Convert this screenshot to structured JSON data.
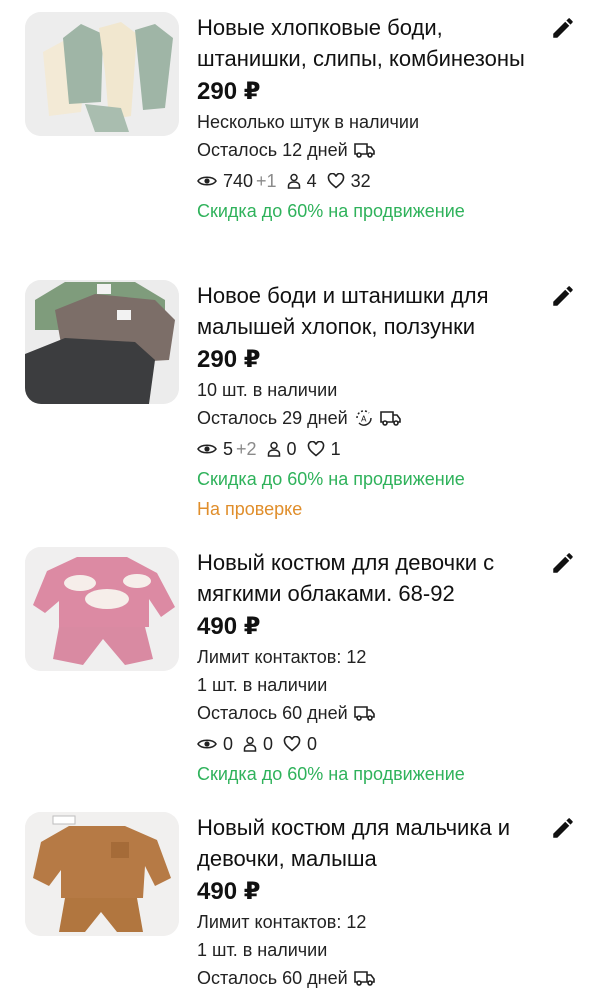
{
  "listings": [
    {
      "title": "Новые хлопковые боди, штанишки, слипы, комбинезоны",
      "price": "290 ₽",
      "stock": "Несколько штук в наличии",
      "days_left": "Осталось 12 дней",
      "views": "740",
      "views_delta": "+1",
      "contacts": "4",
      "favorites": "32",
      "promo": "Скидка до 60% на продвижение"
    },
    {
      "title": "Новое боди и штанишки для малышей хлопок, ползунки",
      "price": "290 ₽",
      "stock": "10 шт. в наличии",
      "days_left": "Осталось 29 дней",
      "views": "5",
      "views_delta": "+2",
      "contacts": "0",
      "favorites": "1",
      "promo": "Скидка до 60% на продвижение",
      "status": "На проверке"
    },
    {
      "title": "Новый костюм для девочки с мягкими облаками. 68-92",
      "price": "490 ₽",
      "contact_limit": "Лимит контактов: 12",
      "stock": "1 шт. в наличии",
      "days_left": "Осталось 60 дней",
      "views": "0",
      "contacts": "0",
      "favorites": "0",
      "promo": "Скидка до 60% на продвижение"
    },
    {
      "title": "Новый костюм для мальчика и девочки, малыша",
      "price": "490 ₽",
      "contact_limit": "Лимит контактов: 12",
      "stock": "1 шт. в наличии",
      "days_left": "Осталось 60 дней"
    }
  ],
  "colors": {
    "promo": "#2fb25b",
    "status_review": "#e08e2b",
    "muted": "#8a8a8a"
  },
  "icons": [
    "pencil-icon",
    "eye-icon",
    "person-icon",
    "heart-icon",
    "truck-icon",
    "autorenew-icon"
  ]
}
